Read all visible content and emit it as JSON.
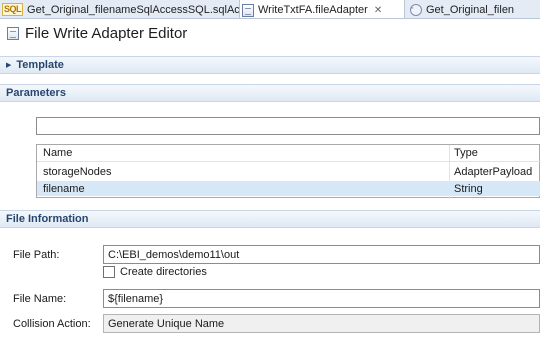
{
  "tabs": [
    {
      "label": "Get_Original_filenameSqlAccessSQL.sqlAccess",
      "icon": "sql-icon",
      "active": false
    },
    {
      "label": "WriteTxtFA.fileAdapter",
      "icon": "file-adapter-icon",
      "active": true,
      "close": "✕"
    },
    {
      "label": "Get_Original_filen",
      "icon": "service-icon",
      "active": false
    }
  ],
  "editor": {
    "title": "File Write Adapter Editor"
  },
  "sections": {
    "template": "Template",
    "parameters": "Parameters",
    "file_information": "File Information"
  },
  "parameters": {
    "filter_value": "",
    "columns": {
      "name": "Name",
      "type": "Type"
    },
    "rows": [
      {
        "name": "storageNodes",
        "type": "AdapterPayload"
      },
      {
        "name": "filename",
        "type": "String",
        "selected": true
      }
    ]
  },
  "file_information": {
    "file_path_label": "File Path:",
    "file_path_value": "C:\\EBI_demos\\demo11\\out",
    "create_directories_label": "Create directories",
    "create_directories_checked": false,
    "file_name_label": "File Name:",
    "file_name_value": "${filename}",
    "collision_action_label": "Collision Action:",
    "collision_action_value": "Generate Unique Name"
  },
  "colors": {
    "section_text": "#27466f",
    "selection": "#d6e8f7",
    "tab_bg": "#e4ebf5"
  }
}
